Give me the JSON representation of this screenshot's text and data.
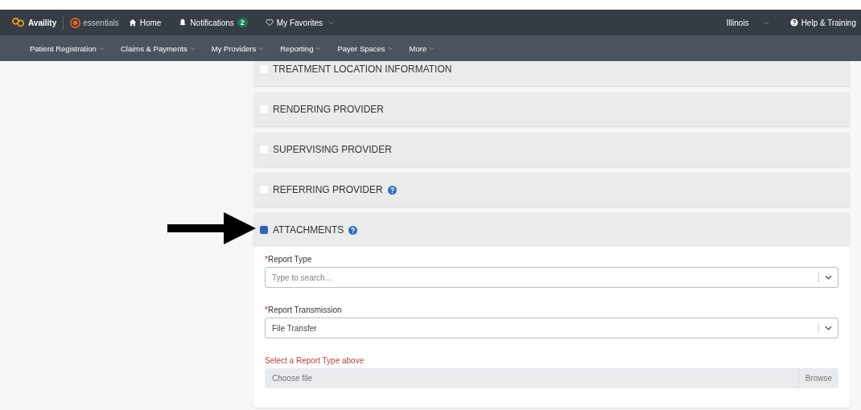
{
  "top_bar": {
    "brand": "Availity",
    "product": "essentials",
    "home": "Home",
    "notifications": {
      "label": "Notifications",
      "count": "2"
    },
    "favorites": "My Favorites",
    "region": "Illinois",
    "help": "Help & Training"
  },
  "nav": [
    "Patient Registration",
    "Claims & Payments",
    "My Providers",
    "Reporting",
    "Payer Spaces",
    "More"
  ],
  "sections": [
    {
      "title": "TREATMENT LOCATION INFORMATION",
      "checked": false,
      "help": false
    },
    {
      "title": "RENDERING PROVIDER",
      "checked": false,
      "help": false
    },
    {
      "title": "SUPERVISING PROVIDER",
      "checked": false,
      "help": false
    },
    {
      "title": "REFERRING PROVIDER",
      "checked": false,
      "help": true
    },
    {
      "title": "ATTACHMENTS",
      "checked": true,
      "help": true
    }
  ],
  "attachments": {
    "fields": [
      {
        "kind": "select",
        "label": "Report Type",
        "required_mark": "*",
        "placeholder": "Type to search..."
      },
      {
        "kind": "select",
        "label": "Report Transmission",
        "required_mark": "*",
        "value": "File Transfer"
      },
      {
        "kind": "file",
        "error": "Select a Report Type above",
        "placeholder": "Choose file",
        "button": "Browse"
      }
    ]
  },
  "annotation": {
    "kind": "arrow"
  }
}
